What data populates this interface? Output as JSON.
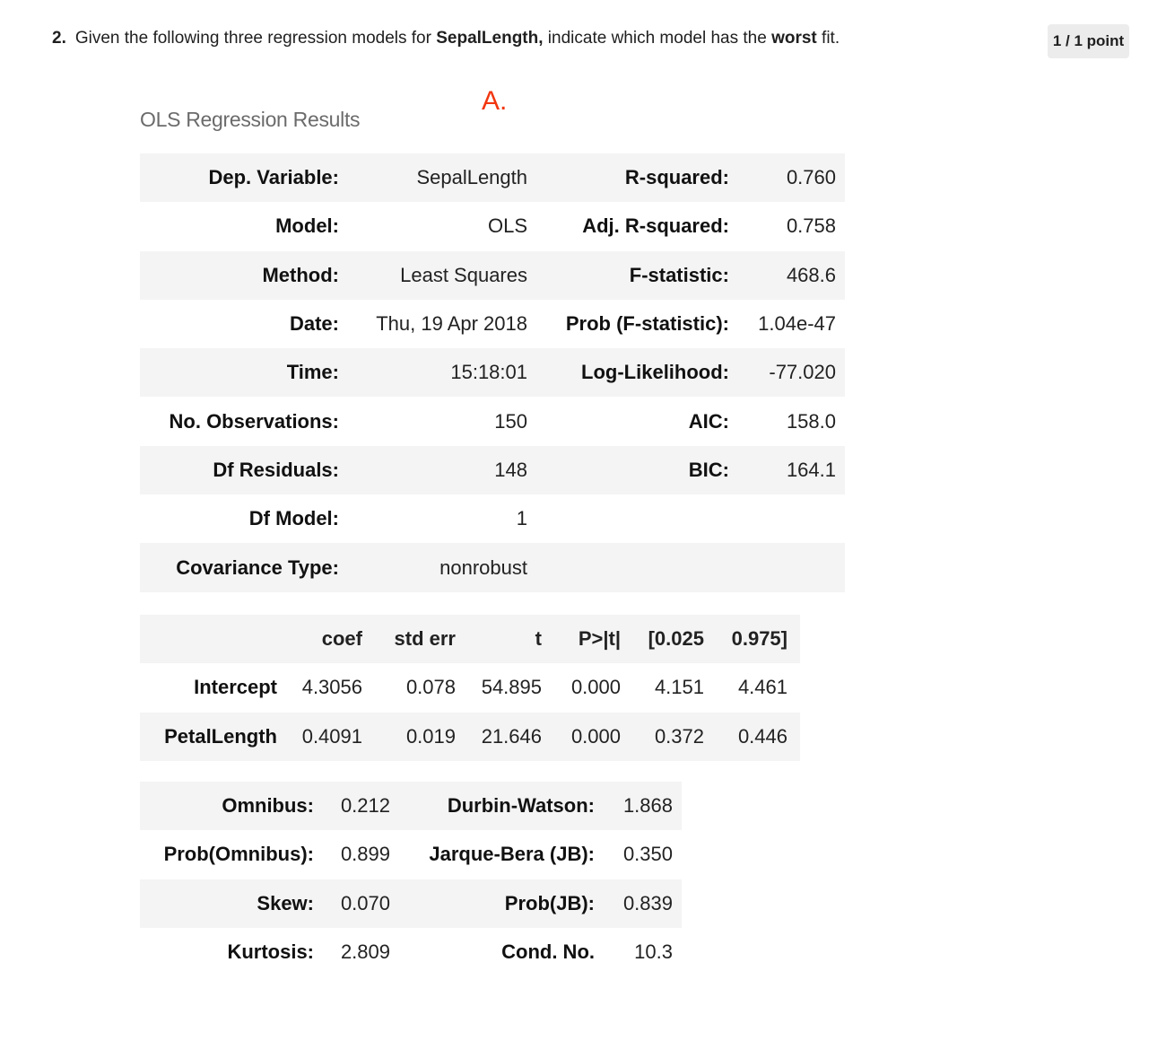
{
  "question": {
    "number": "2.",
    "text_before": "Given the following three regression models for ",
    "bold_var": "SepalLength,",
    "text_middle": " indicate which model has the ",
    "bold_word": "worst",
    "text_after": " fit."
  },
  "points": "1 / 1 point",
  "model_letter": "A.",
  "ols_title": "OLS Regression Results",
  "summary": {
    "rows": [
      {
        "l1": "Dep. Variable:",
        "v1": "SepalLength",
        "l2": "R-squared:",
        "v2": "0.760"
      },
      {
        "l1": "Model:",
        "v1": "OLS",
        "l2": "Adj. R-squared:",
        "v2": "0.758"
      },
      {
        "l1": "Method:",
        "v1": "Least Squares",
        "l2": "F-statistic:",
        "v2": "468.6"
      },
      {
        "l1": "Date:",
        "v1": "Thu, 19 Apr 2018",
        "l2": "Prob (F-statistic):",
        "v2": "1.04e-47"
      },
      {
        "l1": "Time:",
        "v1": "15:18:01",
        "l2": "Log-Likelihood:",
        "v2": "-77.020"
      },
      {
        "l1": "No. Observations:",
        "v1": "150",
        "l2": "AIC:",
        "v2": "158.0"
      },
      {
        "l1": "Df Residuals:",
        "v1": "148",
        "l2": "BIC:",
        "v2": "164.1"
      },
      {
        "l1": "Df Model:",
        "v1": "1",
        "l2": "",
        "v2": ""
      },
      {
        "l1": "Covariance Type:",
        "v1": "nonrobust",
        "l2": "",
        "v2": ""
      }
    ]
  },
  "coefficients": {
    "headers": [
      "",
      "coef",
      "std err",
      "t",
      "P>|t|",
      "[0.025",
      "0.975]"
    ],
    "rows": [
      [
        "Intercept",
        "4.3056",
        "0.078",
        "54.895",
        "0.000",
        "4.151",
        "4.461"
      ],
      [
        "PetalLength",
        "0.4091",
        "0.019",
        "21.646",
        "0.000",
        "0.372",
        "0.446"
      ]
    ]
  },
  "diagnostics": {
    "rows": [
      {
        "l1": "Omnibus:",
        "v1": "0.212",
        "l2": "Durbin-Watson:",
        "v2": "1.868"
      },
      {
        "l1": "Prob(Omnibus):",
        "v1": "0.899",
        "l2": "Jarque-Bera (JB):",
        "v2": "0.350"
      },
      {
        "l1": "Skew:",
        "v1": "0.070",
        "l2": "Prob(JB):",
        "v2": "0.839"
      },
      {
        "l1": "Kurtosis:",
        "v1": "2.809",
        "l2": "Cond. No.",
        "v2": "10.3"
      }
    ]
  }
}
